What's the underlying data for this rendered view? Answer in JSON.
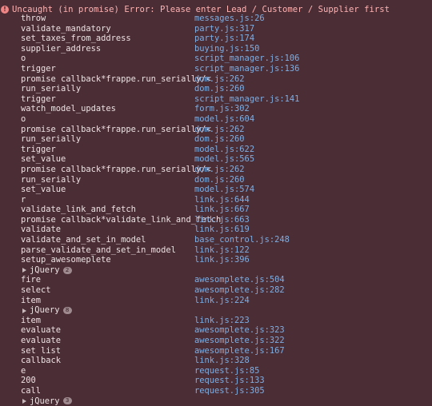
{
  "error": {
    "icon": "error-circle-icon",
    "message": "Uncaught (in promise) Error: Please enter Lead / Customer / Supplier first"
  },
  "stack": [
    {
      "type": "frame",
      "fn": "throw",
      "loc": "messages.js:26"
    },
    {
      "type": "frame",
      "fn": "validate_mandatory",
      "loc": "party.js:317"
    },
    {
      "type": "frame",
      "fn": "set_taxes_from_address",
      "loc": "party.js:174"
    },
    {
      "type": "frame",
      "fn": "supplier_address",
      "loc": "buying.js:150"
    },
    {
      "type": "frame",
      "fn": "o",
      "loc": "script_manager.js:106"
    },
    {
      "type": "frame",
      "fn": "trigger",
      "loc": "script_manager.js:136"
    },
    {
      "type": "frame",
      "fn": "promise callback*frappe.run_serially/<",
      "loc": "dom.js:262"
    },
    {
      "type": "frame",
      "fn": "run_serially",
      "loc": "dom.js:260"
    },
    {
      "type": "frame",
      "fn": "trigger",
      "loc": "script_manager.js:141"
    },
    {
      "type": "frame",
      "fn": "watch_model_updates",
      "loc": "form.js:302"
    },
    {
      "type": "frame",
      "fn": "o",
      "loc": "model.js:604"
    },
    {
      "type": "frame",
      "fn": "promise callback*frappe.run_serially/<",
      "loc": "dom.js:262"
    },
    {
      "type": "frame",
      "fn": "run_serially",
      "loc": "dom.js:260"
    },
    {
      "type": "frame",
      "fn": "trigger",
      "loc": "model.js:622"
    },
    {
      "type": "frame",
      "fn": "set_value",
      "loc": "model.js:565"
    },
    {
      "type": "frame",
      "fn": "promise callback*frappe.run_serially/<",
      "loc": "dom.js:262"
    },
    {
      "type": "frame",
      "fn": "run_serially",
      "loc": "dom.js:260"
    },
    {
      "type": "frame",
      "fn": "set_value",
      "loc": "model.js:574"
    },
    {
      "type": "frame",
      "fn": "r",
      "loc": "link.js:644"
    },
    {
      "type": "frame",
      "fn": "validate_link_and_fetch",
      "loc": "link.js:667"
    },
    {
      "type": "frame",
      "fn": "promise callback*validate_link_and_fetch",
      "loc": "link.js:663"
    },
    {
      "type": "frame",
      "fn": "validate",
      "loc": "link.js:619"
    },
    {
      "type": "frame",
      "fn": "validate_and_set_in_model",
      "loc": "base_control.js:248"
    },
    {
      "type": "frame",
      "fn": "parse_validate_and_set_in_model",
      "loc": "link.js:122"
    },
    {
      "type": "frame",
      "fn": "setup_awesomeplete",
      "loc": "link.js:396"
    },
    {
      "type": "group",
      "label": "jQuery",
      "count": "2"
    },
    {
      "type": "frame",
      "fn": "fire",
      "loc": "awesomplete.js:504"
    },
    {
      "type": "frame",
      "fn": "select",
      "loc": "awesomplete.js:282"
    },
    {
      "type": "frame",
      "fn": "item",
      "loc": "link.js:224"
    },
    {
      "type": "group",
      "label": "jQuery",
      "count": "8"
    },
    {
      "type": "frame",
      "fn": "item",
      "loc": "link.js:223"
    },
    {
      "type": "frame",
      "fn": "evaluate",
      "loc": "awesomplete.js:323"
    },
    {
      "type": "frame",
      "fn": "evaluate",
      "loc": "awesomplete.js:322"
    },
    {
      "type": "frame",
      "fn": "set list",
      "loc": "awesomplete.js:167"
    },
    {
      "type": "frame",
      "fn": "callback",
      "loc": "link.js:328"
    },
    {
      "type": "frame",
      "fn": "e",
      "loc": "request.js:85"
    },
    {
      "type": "frame",
      "fn": "200",
      "loc": "request.js:133"
    },
    {
      "type": "frame",
      "fn": "call",
      "loc": "request.js:305"
    },
    {
      "type": "group",
      "label": "jQuery",
      "count": "3"
    }
  ]
}
